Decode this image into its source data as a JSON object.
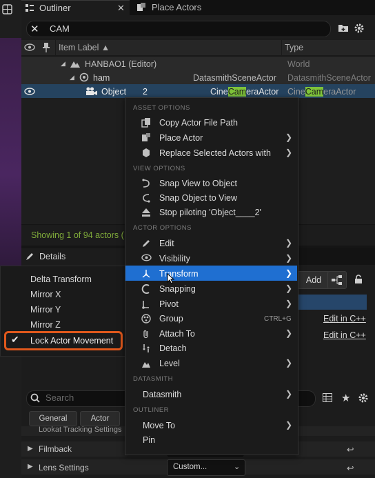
{
  "tabs": {
    "outliner": "Outliner",
    "place_actors": "Place Actors"
  },
  "outliner": {
    "search_value": "CAM",
    "columns": {
      "item_label": "Item Label ▲",
      "type": "Type"
    },
    "rows": [
      {
        "label": "HANBAO1 (Editor)",
        "type": "World"
      },
      {
        "label": "ham",
        "type_left": "DatasmithSceneActor",
        "type": "DatasmithSceneActor"
      },
      {
        "label": "Object",
        "number": "2",
        "type_left_a": "Cine",
        "type_left_b": "Cam",
        "type_left_c": "eraActor",
        "type_a": "Cine",
        "type_b": "Cam",
        "type_c": "eraActor"
      }
    ],
    "status": "Showing 1 of 94 actors ("
  },
  "details": {
    "tab": "Details",
    "add_button": "Add",
    "edit_cpp_1": "Edit in C++",
    "edit_cpp_2": "Edit in C++",
    "search_placeholder": "Search",
    "chips": [
      "General",
      "Actor"
    ],
    "categories": {
      "lookat": "Lookat Tracking Settings",
      "filmback": "Filmback",
      "lens": "Lens Settings"
    },
    "lens_value": "Custom..."
  },
  "transform_submenu": {
    "items": [
      "Delta Transform",
      "Mirror X",
      "Mirror Y",
      "Mirror Z",
      "Lock Actor Movement"
    ],
    "checked_item": "Lock Actor Movement",
    "highlight_color": "#e0581c"
  },
  "context_menu": {
    "sections": {
      "asset": "ASSET OPTIONS",
      "view": "VIEW OPTIONS",
      "actor": "ACTOR OPTIONS",
      "datasmith": "DATASMITH",
      "outliner": "OUTLINER"
    },
    "asset_items": [
      "Copy Actor File Path",
      "Place Actor",
      "Replace Selected Actors with"
    ],
    "view_items": [
      "Snap View to Object",
      "Snap Object to View",
      "Stop piloting 'Object____2'"
    ],
    "actor_items": [
      "Edit",
      "Visibility",
      "Transform",
      "Snapping",
      "Pivot",
      "Group",
      "Attach To",
      "Detach",
      "Level"
    ],
    "group_shortcut": "CTRL+G",
    "datasmith_items": [
      "Datasmith"
    ],
    "outliner_items": [
      "Move To",
      "Pin"
    ],
    "active_item": "Transform",
    "active_color": "#1f6fd1"
  }
}
